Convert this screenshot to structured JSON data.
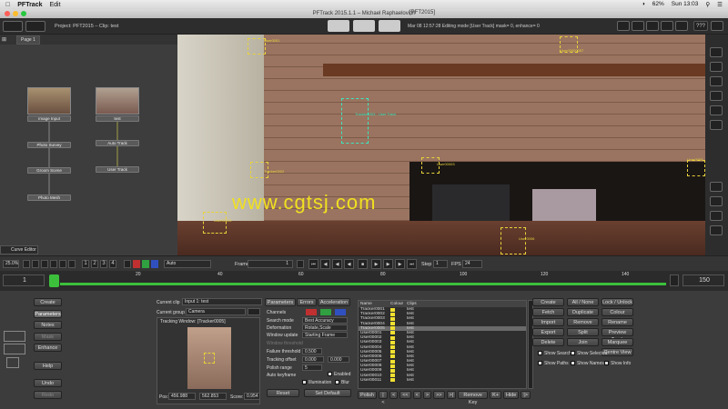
{
  "menubar": {
    "app": "PFTrack",
    "edit": "Edit",
    "wifi": "",
    "battery": "62%",
    "time": "Sun 13:03"
  },
  "window": {
    "title": "PFTrack 2015.1.1 – Michael Raphaelovich",
    "badge": "[PFT2015]"
  },
  "topbar": {
    "project": "Project: PFT2015 – Clip: test",
    "status": "Mar 08 12:57:28 Editing mode [User Track] mask= 0, enhance= 0",
    "help": "???"
  },
  "node_editor": {
    "page_tab": "Page 1",
    "nodes": [
      "Image Input",
      "Photo Survey",
      "Groom Scene",
      "Photo Mesh",
      "test",
      "Auto Track",
      "User Track"
    ],
    "curve_editor": "Curve Editor"
  },
  "viewport": {
    "watermark": "www.cgtsj.com",
    "trackers": [
      "User0001",
      "User00000057",
      "Tracker0002",
      "User00003",
      "User00002",
      "User0006",
      "User0005"
    ],
    "selected_label": "Tracker0003 - User Track"
  },
  "playback": {
    "zoom": "25.0%",
    "views": [
      "1",
      "2",
      "3",
      "4"
    ],
    "display": "Auto",
    "frame_label": "Frame",
    "frame": "1",
    "step_label": "Step",
    "step": "1",
    "fps_label": "FPS",
    "fps": "24"
  },
  "timeline": {
    "start": "1",
    "end": "150",
    "ticks": [
      "20",
      "40",
      "60",
      "80",
      "100",
      "120",
      "140"
    ]
  },
  "left_buttons": [
    "Create",
    "Parameters",
    "Notes",
    "Mask",
    "Enhance",
    "Help",
    "Undo",
    "Redo"
  ],
  "params": {
    "current_clip_label": "Current clip",
    "current_clip": "Input 1: test",
    "current_group_label": "Current group",
    "current_group": "Camera",
    "tracking_window": "Tracking Window: [Tracker0005]",
    "pos_label": "Pos:",
    "pos_x": "456.988",
    "pos_y": "562.853",
    "score_label": "Score:",
    "score": "0.954",
    "tabs": [
      "Parameters",
      "Errors",
      "Acceleration"
    ],
    "channels_label": "Channels",
    "search_mode_label": "Search mode",
    "search_mode": "Best Accuracy",
    "deformation_label": "Deformation",
    "deformation": "Rotate,Scale",
    "window_update_label": "Window update",
    "window_update": "Starting Frame",
    "window_threshold_label": "Window threshold",
    "failure_threshold_label": "Failure threshold",
    "failure_threshold": "0.500",
    "tracking_offset_label": "Tracking offset",
    "tracking_offset_x": "0.000",
    "tracking_offset_y": "0.000",
    "polish_range_label": "Polish range",
    "polish_range": "5",
    "auto_keyframe_label": "Auto keyframe",
    "enabled_label": "Enabled",
    "illumination_label": "Illumination",
    "blur_label": "Blur",
    "reset": "Reset",
    "set_default": "Set Default"
  },
  "tracker_list": {
    "headers": [
      "Name",
      "Colour",
      "Clips"
    ],
    "rows": [
      {
        "name": "Tracker0001",
        "clip": "test"
      },
      {
        "name": "Tracker0002",
        "clip": "test"
      },
      {
        "name": "Tracker0003",
        "clip": "test"
      },
      {
        "name": "Tracker0004",
        "clip": "test"
      },
      {
        "name": "Tracker0005",
        "clip": "test"
      },
      {
        "name": "User00001",
        "clip": "test"
      },
      {
        "name": "User00002",
        "clip": "test"
      },
      {
        "name": "User00003",
        "clip": "test"
      },
      {
        "name": "User00004",
        "clip": "test"
      },
      {
        "name": "User00005",
        "clip": "test"
      },
      {
        "name": "User00006",
        "clip": "test"
      },
      {
        "name": "User00007",
        "clip": "test"
      },
      {
        "name": "User00008",
        "clip": "test"
      },
      {
        "name": "User00009",
        "clip": "test"
      },
      {
        "name": "User00010",
        "clip": "test"
      },
      {
        "name": "User00011",
        "clip": "test"
      }
    ],
    "selected_index": 4,
    "swatch_color": "#f0e030",
    "footer": [
      "Polish",
      "|<",
      "<",
      "<<",
      "<",
      ">",
      ">>",
      ">|",
      "Remove Key",
      "K+",
      "Hide",
      "|>"
    ]
  },
  "right_buttons": [
    [
      "Create",
      "All / None",
      "Lock / Unlock"
    ],
    [
      "Fetch",
      "Duplicate",
      "Colour"
    ],
    [
      "Import",
      "Remove",
      "Rename"
    ],
    [
      "Export",
      "Split",
      "Preview Track"
    ],
    [
      "Delete",
      "Join",
      "Marquee"
    ],
    [
      "",
      "",
      "Centre View"
    ]
  ],
  "checkboxes": [
    "Show Search",
    "Show Selected",
    "Show Paths",
    "Show Names",
    "Show Info"
  ]
}
